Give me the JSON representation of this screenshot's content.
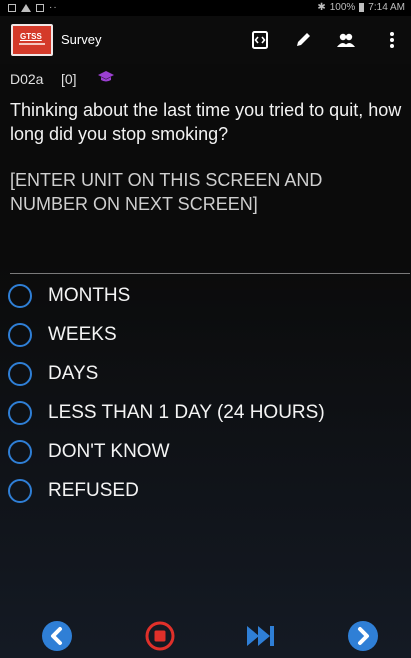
{
  "status_bar": {
    "battery": "100%",
    "time": "7:14 AM",
    "icons": [
      "image-icon",
      "warning-icon",
      "screen-icon",
      "more-dots-icon",
      "bluetooth-icon",
      "battery-icon"
    ]
  },
  "action_bar": {
    "logo_text": "GTSS",
    "title": "Survey",
    "icons": [
      "code-brackets-icon",
      "pencil-icon",
      "people-icon",
      "overflow-menu-icon"
    ]
  },
  "question": {
    "id": "D02a",
    "count": "[0]",
    "text": "Thinking about the last time you tried to quit, how long did you stop smoking?",
    "instruction": "[ENTER UNIT ON THIS SCREEN AND NUMBER ON NEXT SCREEN]",
    "badge_icon": "graduation-cap-icon"
  },
  "options": [
    {
      "label": "MONTHS",
      "selected": false
    },
    {
      "label": "WEEKS",
      "selected": false
    },
    {
      "label": "DAYS",
      "selected": false
    },
    {
      "label": "LESS THAN 1 DAY (24 HOURS)",
      "selected": false
    },
    {
      "label": "DON'T KNOW",
      "selected": false
    },
    {
      "label": "REFUSED",
      "selected": false
    }
  ],
  "bottom_nav": {
    "icons": [
      "back-icon",
      "stop-icon",
      "fast-forward-icon",
      "next-icon"
    ]
  },
  "colors": {
    "accent_blue": "#2f7fd6",
    "stop_red": "#e0302a",
    "logo_red": "#d43a2a",
    "cap_purple": "#9b3fd1"
  }
}
